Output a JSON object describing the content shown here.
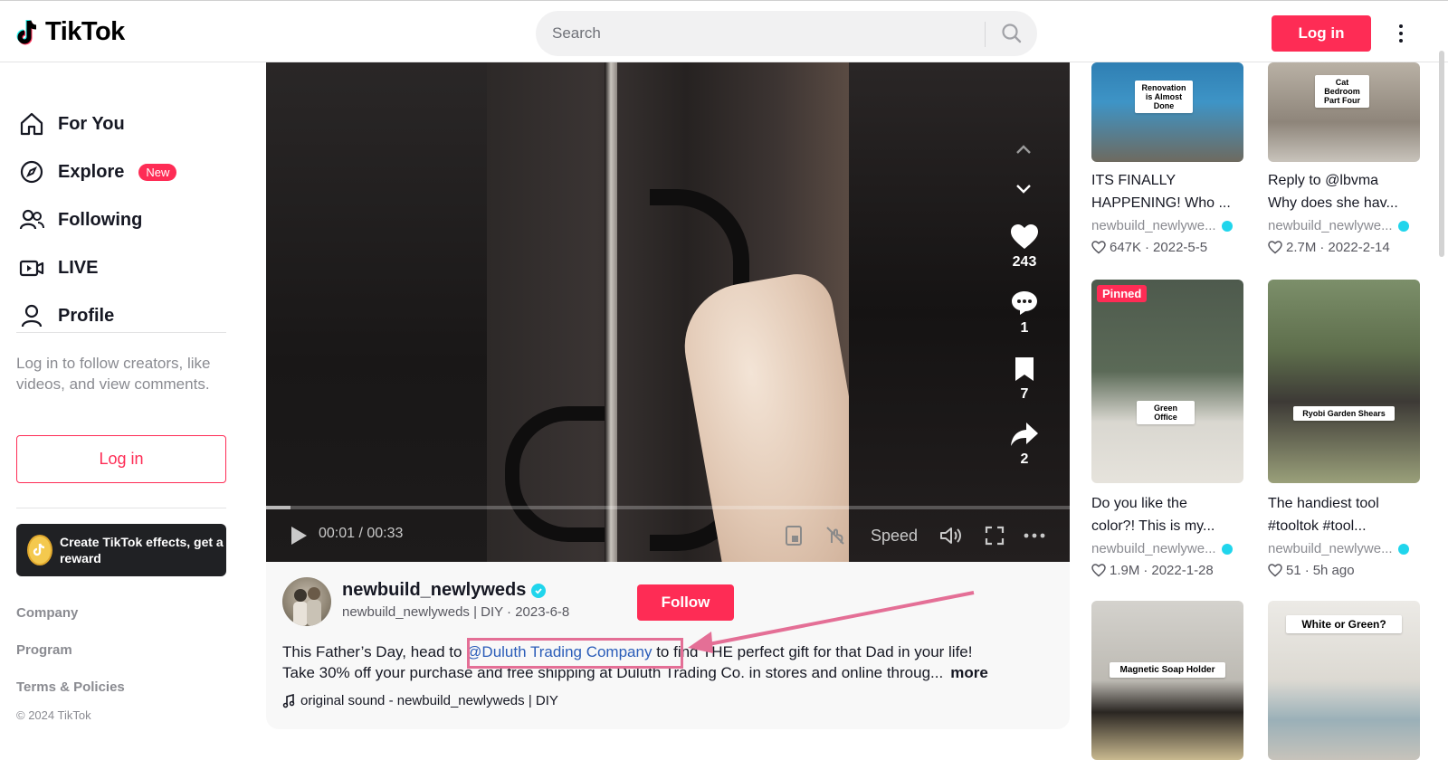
{
  "header": {
    "logo_text": "TikTok",
    "search_placeholder": "Search",
    "login_label": "Log in"
  },
  "sidebar": {
    "items": [
      {
        "label": "For You",
        "icon": "home-icon"
      },
      {
        "label": "Explore",
        "icon": "compass-icon",
        "badge": "New"
      },
      {
        "label": "Following",
        "icon": "users-icon"
      },
      {
        "label": "LIVE",
        "icon": "live-icon"
      },
      {
        "label": "Profile",
        "icon": "person-icon"
      }
    ],
    "login_hint": "Log in to follow creators, like videos, and view comments.",
    "login_button": "Log in",
    "effects_banner": "Create TikTok effects, get a reward",
    "footer_links": [
      "Company",
      "Program",
      "Terms & Policies"
    ],
    "copyright": "© 2024 TikTok"
  },
  "video": {
    "time": "00:01 / 00:33",
    "progress": 0.03,
    "speed_label": "Speed",
    "likes": "243",
    "comments": "1",
    "saves": "7",
    "shares": "2"
  },
  "post": {
    "author": "newbuild_newlyweds",
    "author_sub": "newbuild_newlyweds | DIY · 2023-6-8",
    "follow_label": "Follow",
    "desc_line1_before": "This Father’s Day, head to ",
    "mention": "@Duluth Trading Company",
    "desc_line1_after": " to find THE perfect gift for that Dad in your life!",
    "desc_line2": "Take 30% off your purchase and free shipping at Duluth Trading Co. in stores and online throug...",
    "more_label": "more",
    "sound": "original sound - newbuild_newlyweds | DIY"
  },
  "related": [
    {
      "title1": "ITS FINALLY",
      "title2": "HAPPENING! Who ...",
      "author": "newbuild_newlywe...",
      "likes": "647K",
      "date": "2022-5-5",
      "thumb_label": "Renovation is Almost Done"
    },
    {
      "title1": "Reply to @lbvma",
      "title2": "Why does she hav...",
      "author": "newbuild_newlywe...",
      "likes": "2.7M",
      "date": "2022-2-14",
      "thumb_label": "Cat Bedroom Part Four"
    },
    {
      "title1": "Do you like the",
      "title2": "color?! This is my...",
      "author": "newbuild_newlywe...",
      "likes": "1.9M",
      "date": "2022-1-28",
      "thumb_label": "Green Office",
      "pinned": "Pinned"
    },
    {
      "title1": "The handiest tool",
      "title2": "#tooltok #tool...",
      "author": "newbuild_newlywe...",
      "likes": "51",
      "date": "5h ago",
      "thumb_label": "Ryobi Garden Shears"
    },
    {
      "thumb_label": "Magnetic Soap Holder"
    },
    {
      "thumb_label": "White or Green?"
    }
  ],
  "colors": {
    "brand": "#fe2c55",
    "verified": "#20d5ec",
    "mention": "#2b5db9",
    "annotation": "#e46f96"
  }
}
